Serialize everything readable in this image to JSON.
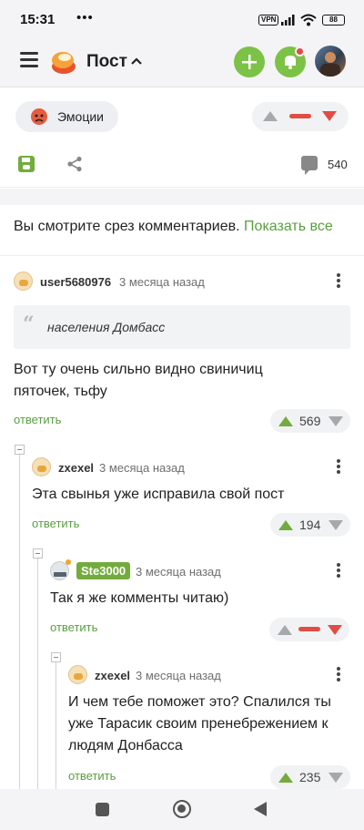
{
  "status_bar": {
    "time": "15:31",
    "dots": "•••",
    "vpn": "VPN",
    "battery": "88"
  },
  "header": {
    "title": "Пост",
    "title_chevron": "^"
  },
  "post_actions": {
    "emotion_label": "Эмоции",
    "comments_count": "540"
  },
  "slice_notice": {
    "text": "Вы смотрите срез комментариев.",
    "link": "Показать все"
  },
  "comments": [
    {
      "user": "user5680976",
      "time": "3 месяца назад",
      "quote": "населения Домбасс",
      "text": "Вот ту очень сильно видно свиничиц пяточек, тьфу",
      "reply": "ответить",
      "rating": "569"
    },
    {
      "user": "zxexel",
      "time": "3 месяца назад",
      "text": "Эта свынья уже исправила свой пост",
      "reply": "ответить",
      "rating": "194"
    },
    {
      "user": "Ste3000",
      "time": "3 месяца назад",
      "text": "Так я же комменты читаю)",
      "reply": "ответить",
      "rating": ""
    },
    {
      "user": "zxexel",
      "time": "3 месяца назад",
      "text": "И чем тебе поможет это? Спалился ты уже Тарасик своим пренебрежением к людям Донбасса",
      "reply": "ответить",
      "rating": "235"
    }
  ],
  "colors": {
    "accent_green": "#7cc247",
    "link_green": "#58a03e",
    "downvote_red": "#e24c44",
    "background": "#ffffff",
    "bar_bg": "#f4f4f6"
  },
  "icons": [
    "menu-icon",
    "pikabu-logo",
    "plus-icon",
    "bell-icon",
    "emotion-face-icon",
    "save-icon",
    "share-icon",
    "comments-icon",
    "quote-icon",
    "more-icon",
    "upvote-icon",
    "downvote-icon",
    "nav-square-icon",
    "nav-home-icon",
    "nav-back-icon"
  ]
}
